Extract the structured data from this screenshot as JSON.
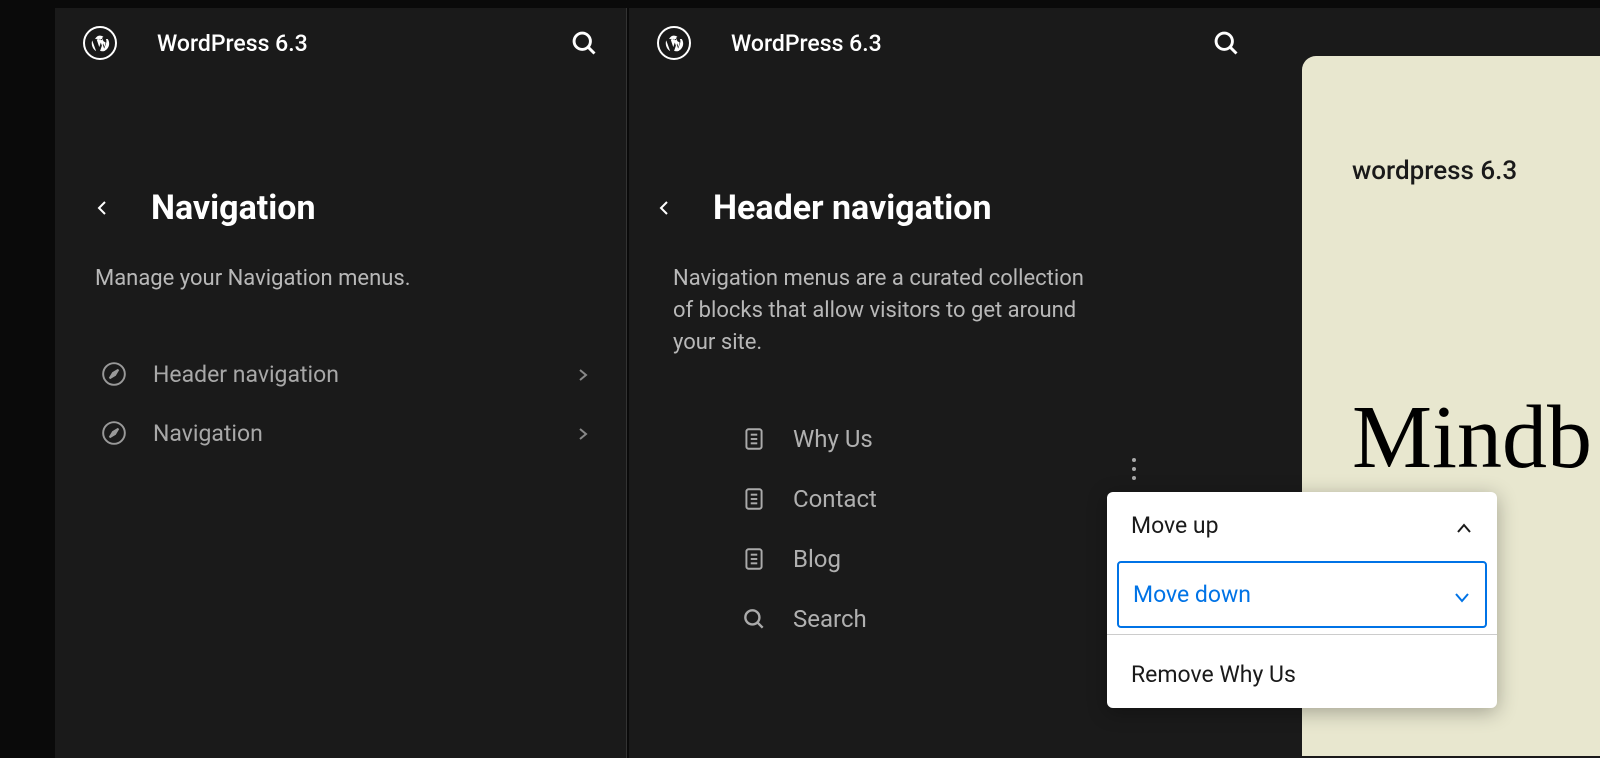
{
  "site_title": "WordPress 6.3",
  "left_panel": {
    "title": "Navigation",
    "description": "Manage your Navigation menus.",
    "items": [
      {
        "label": "Header navigation"
      },
      {
        "label": "Navigation"
      }
    ]
  },
  "right_panel": {
    "title": "Header navigation",
    "description": "Navigation menus are a curated collection of blocks that allow visitors to get around your site.",
    "menu_items": [
      {
        "label": "Why Us",
        "icon": "page"
      },
      {
        "label": "Contact",
        "icon": "page"
      },
      {
        "label": "Blog",
        "icon": "page"
      },
      {
        "label": "Search",
        "icon": "search"
      }
    ]
  },
  "preview": {
    "small_title": "wordpress 6.3",
    "big_text": "Mindb"
  },
  "context_menu": {
    "move_up": "Move up",
    "move_down": "Move down",
    "remove": "Remove Why Us"
  }
}
